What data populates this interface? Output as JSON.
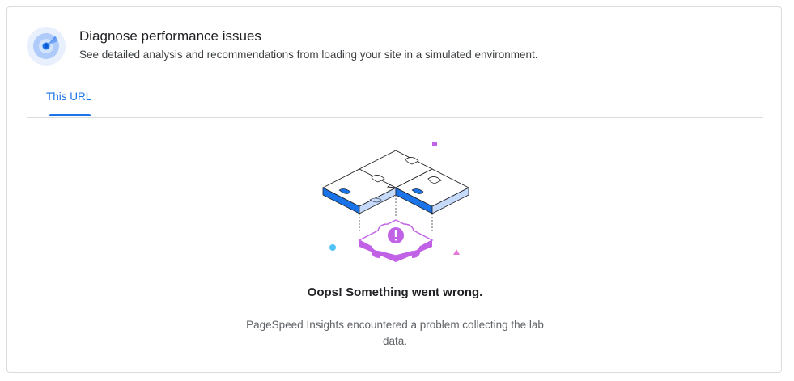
{
  "header": {
    "title": "Diagnose performance issues",
    "subtitle": "See detailed analysis and recommendations from loading your site in a simulated environment.",
    "icon": "performance-gauge-icon"
  },
  "tabs": [
    {
      "label": "This URL",
      "active": true
    }
  ],
  "error": {
    "title": "Oops! Something went wrong.",
    "message": "PageSpeed Insights encountered a problem collecting the lab data."
  },
  "colors": {
    "accent": "#1a73e8",
    "puzzle_blue": "#1a73e8",
    "puzzle_light_blue": "#c6dafc",
    "puzzle_purple": "#c061e6",
    "error_badge": "#c061e6"
  }
}
